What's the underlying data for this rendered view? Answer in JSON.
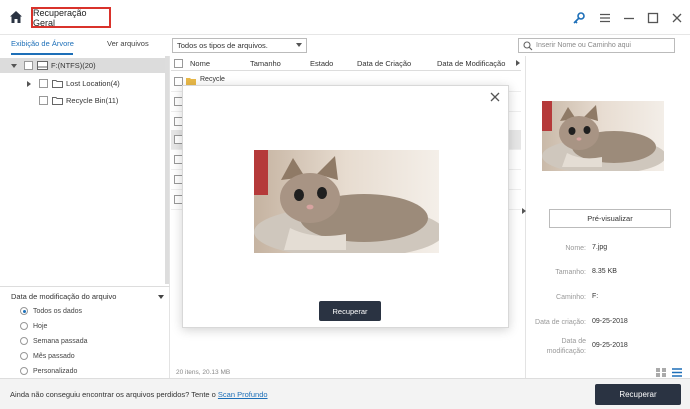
{
  "header": {
    "title": "Recuperação Geral"
  },
  "tabs": {
    "tree_view": "Exibição de Árvore",
    "file_view": "Ver arquivos"
  },
  "filter": {
    "selected": "Todos os tipos de arquivos."
  },
  "search": {
    "placeholder": "Inserir Nome ou Caminho aqui"
  },
  "tree": [
    {
      "label": "F:(NTFS)(20)"
    },
    {
      "label": "Lost Location(4)"
    },
    {
      "label": "Recycle Bin(11)"
    }
  ],
  "date_filter": {
    "header": "Data de modificação do arquivo",
    "options": [
      "Todos os dados",
      "Hoje",
      "Semana passada",
      "Mês passado",
      "Personalizado"
    ],
    "selected_index": 0
  },
  "table": {
    "columns": [
      "Nome",
      "Tamanho",
      "Estado",
      "Data de Criação",
      "Data de Modificação"
    ],
    "first_row_name": "Recycle"
  },
  "status": {
    "summary": "20 itens, 20.13 MB"
  },
  "preview": {
    "button_label": "Pré-visualizar",
    "fields": [
      {
        "label": "Nome:",
        "value": "7.jpg"
      },
      {
        "label": "Tamanho:",
        "value": "8.35 KB"
      },
      {
        "label": "Caminho:",
        "value": "F:"
      },
      {
        "label": "Data de criação:",
        "value": "09-25-2018"
      },
      {
        "label": "Data de modificação:",
        "value": "09-25-2018"
      }
    ]
  },
  "bottom": {
    "prompt": "Ainda não conseguiu encontrar os arquivos perdidos? Tente o ",
    "deep_scan": "Scan Profundo",
    "recover_label": "Recuperar"
  },
  "modal": {
    "recover_label": "Recuperar"
  },
  "colors": {
    "accent": "#1d6fb8",
    "title_border": "#d9322b",
    "dark_button": "#2a3342"
  }
}
